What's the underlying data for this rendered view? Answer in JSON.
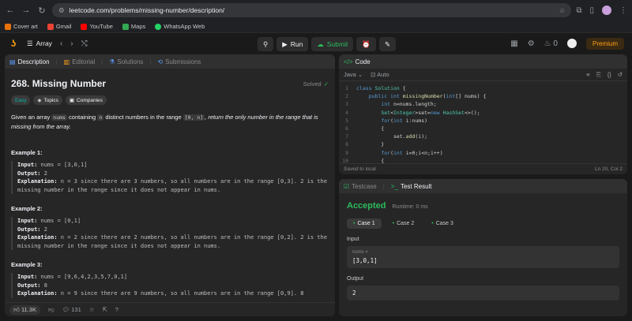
{
  "browser": {
    "url": "leetcode.com/problems/missing-number/description/",
    "bookmarks": [
      "Cover art",
      "Gmail",
      "YouTube",
      "Maps",
      "WhatsApp Web"
    ]
  },
  "appnav": {
    "list_label": "Array",
    "run_label": "Run",
    "submit_label": "Submit",
    "streak": "0",
    "premium_label": "Premium"
  },
  "left": {
    "tabs": [
      "Description",
      "Editorial",
      "Solutions",
      "Submissions"
    ],
    "title": "268. Missing Number",
    "solved": "Solved",
    "chips": [
      "Easy",
      "Topics",
      "Companies"
    ],
    "para": {
      "p1": "Given an array ",
      "c1": "nums",
      "p2": " containing ",
      "c2": "n",
      "p3": " distinct numbers in the range ",
      "c3": "[0, n]",
      "p4": ", return the only number in the range that is missing from the array."
    },
    "examples": [
      {
        "title": "Example 1:",
        "input": "nums = [3,0,1]",
        "output": "2",
        "explanation": "n = 3 since there are 3 numbers, so all numbers are in the range [0,3]. 2 is the missing number in the range since it does not appear in nums."
      },
      {
        "title": "Example 2:",
        "input": "nums = [0,1]",
        "output": "2",
        "explanation": "n = 2 since there are 2 numbers, so all numbers are in the range [0,2]. 2 is the missing number in the range since it does not appear in nums."
      },
      {
        "title": "Example 3:",
        "input": "nums = [9,6,4,2,3,5,7,0,1]",
        "output": "8",
        "explanation": "n = 9 since there are 9 numbers, so all numbers are in the range [0,9]. 8"
      }
    ],
    "labels": {
      "input": "Input:",
      "output": "Output:",
      "explanation": "Explanation:"
    },
    "footer": {
      "likes": "11.3K",
      "comments": "131"
    }
  },
  "code": {
    "tab": "Code",
    "language": "Java",
    "mode": "Auto",
    "saved": "Saved to local",
    "cursor": "Ln 20, Col 2"
  },
  "result": {
    "tabs": [
      "Testcase",
      "Test Result"
    ],
    "status": "Accepted",
    "runtime": "Runtime: 0 ms",
    "cases": [
      "Case 1",
      "Case 2",
      "Case 3"
    ],
    "input_label": "Input",
    "input_key": "nums =",
    "input_value": "[3,0,1]",
    "output_label": "Output",
    "output_value": "2"
  },
  "colors": {
    "accent": "#ffa116",
    "green": "#2cbb5d",
    "bg": "#1a1a1a",
    "panel": "#262626"
  },
  "icons": [
    "back-icon",
    "forward-icon",
    "reload-icon",
    "star-icon",
    "shuffle-icon",
    "timer-icon",
    "notes-icon",
    "layout-icon",
    "gear-icon",
    "flame-icon"
  ]
}
